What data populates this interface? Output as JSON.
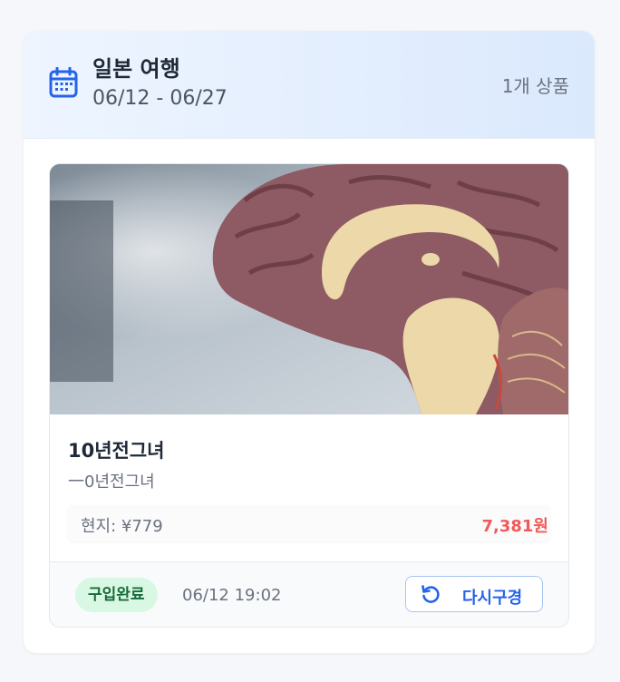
{
  "trip": {
    "title": "일본 여행",
    "dates": "06/12 - 06/27",
    "item_count": "1개 상품"
  },
  "product": {
    "image_icon": "brain-model-photo",
    "name": "10년전그녀",
    "subtitle": "一0년전그녀",
    "local_price": "현지: ¥779",
    "krw_price": "7,381원"
  },
  "purchase": {
    "status": "구입완료",
    "time": "06/12 19:02",
    "rebuy_label": "다시구경"
  },
  "colors": {
    "accent": "#2563eb",
    "price": "#ef5b5b",
    "status_bg": "#d9f8e3",
    "status_text": "#176b3a"
  }
}
